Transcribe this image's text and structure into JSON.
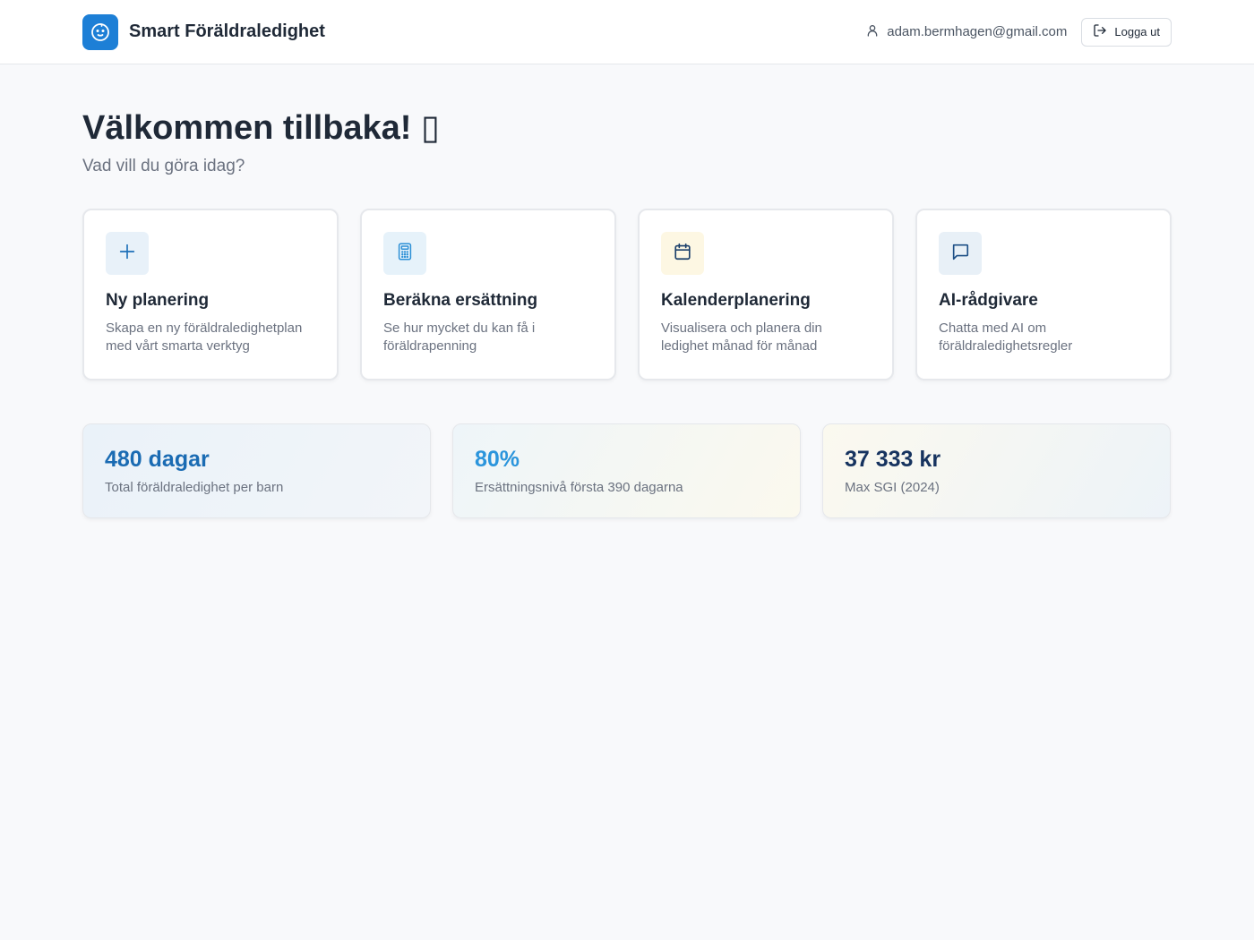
{
  "header": {
    "app_name": "Smart Föräldraledighet",
    "user_email": "adam.bermhagen@gmail.com",
    "logout_label": "Logga ut"
  },
  "welcome": {
    "title": "Välkommen tillbaka!",
    "emoji": "▯",
    "subtitle": "Vad vill du göra idag?"
  },
  "cards": [
    {
      "title": "Ny planering",
      "description": "Skapa en ny föräldraledighetplan med vårt smarta verktyg",
      "icon": "plus-icon",
      "icon_bg": "#e8f1f9",
      "icon_color": "#1d6fb8"
    },
    {
      "title": "Beräkna ersättning",
      "description": "Se hur mycket du kan få i föräldrapenning",
      "icon": "calculator-icon",
      "icon_bg": "#e6f2fa",
      "icon_color": "#2b8fd6"
    },
    {
      "title": "Kalenderplanering",
      "description": "Visualisera och planera din ledighet månad för månad",
      "icon": "calendar-icon",
      "icon_bg": "#fdf7e3",
      "icon_color": "#1b3f6b"
    },
    {
      "title": "AI-rådgivare",
      "description": "Chatta med AI om föräldraledighetsregler",
      "icon": "chat-icon",
      "icon_bg": "#e8f0f7",
      "icon_color": "#1d4f86"
    }
  ],
  "stats": [
    {
      "value": "480 dagar",
      "label": "Total föräldraledighet per barn",
      "color": "#1a6bb3"
    },
    {
      "value": "80%",
      "label": "Ersättningsnivå första 390 dagarna",
      "color": "#2b95dc"
    },
    {
      "value": "37 333 kr",
      "label": "Max SGI (2024)",
      "color": "#16335f"
    }
  ]
}
